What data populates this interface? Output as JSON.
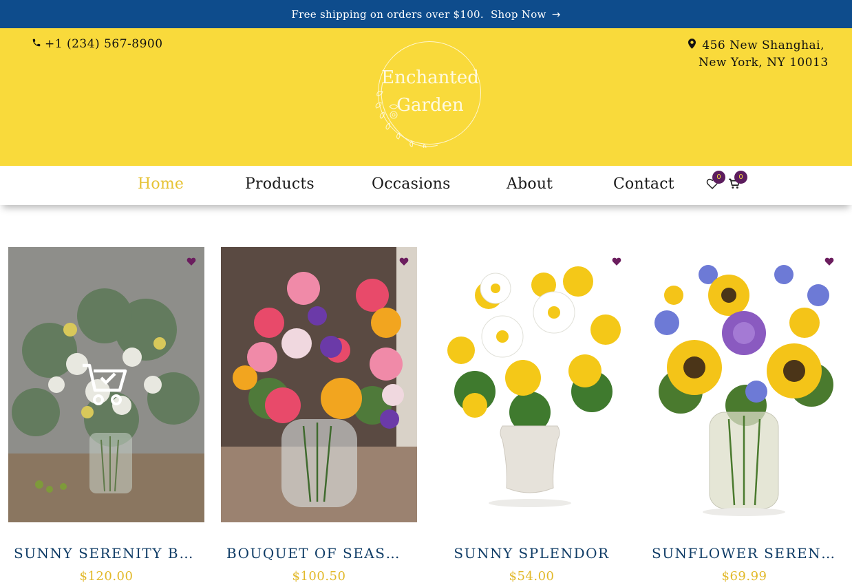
{
  "topbar": {
    "message": "Free shipping on orders over $100.",
    "link_label": "Shop Now",
    "link_icon": "arrow-right-icon"
  },
  "header": {
    "phone": "+1 (234) 567-8900",
    "phone_icon": "phone-icon",
    "address_line1": "456 New Shanghai,",
    "address_line2": "New York, NY 10013",
    "address_icon": "map-pin-icon",
    "logo_line1": "Enchanted",
    "logo_line2": "Garden"
  },
  "nav": {
    "items": [
      {
        "label": "Home",
        "active": true
      },
      {
        "label": "Products",
        "active": false
      },
      {
        "label": "Occasions",
        "active": false
      },
      {
        "label": "About",
        "active": false
      },
      {
        "label": "Contact",
        "active": false
      }
    ],
    "wishlist_count": "0",
    "cart_count": "0"
  },
  "products": [
    {
      "title": "SUNNY SERENITY BOUQUET",
      "price": "$120.00"
    },
    {
      "title": "BOUQUET OF SEASONAL FLOWERS",
      "price": "$100.50"
    },
    {
      "title": "SUNNY SPLENDOR",
      "price": "$54.00"
    },
    {
      "title": "SUNFLOWER SERENITY BOUQUET",
      "price": "$69.99"
    }
  ],
  "colors": {
    "topbar": "#0e4c8c",
    "header": "#f9da3b",
    "active_nav": "#e6c233",
    "badge": "#5c1d5e",
    "title": "#0f3c66",
    "price": "#e2b92a"
  }
}
